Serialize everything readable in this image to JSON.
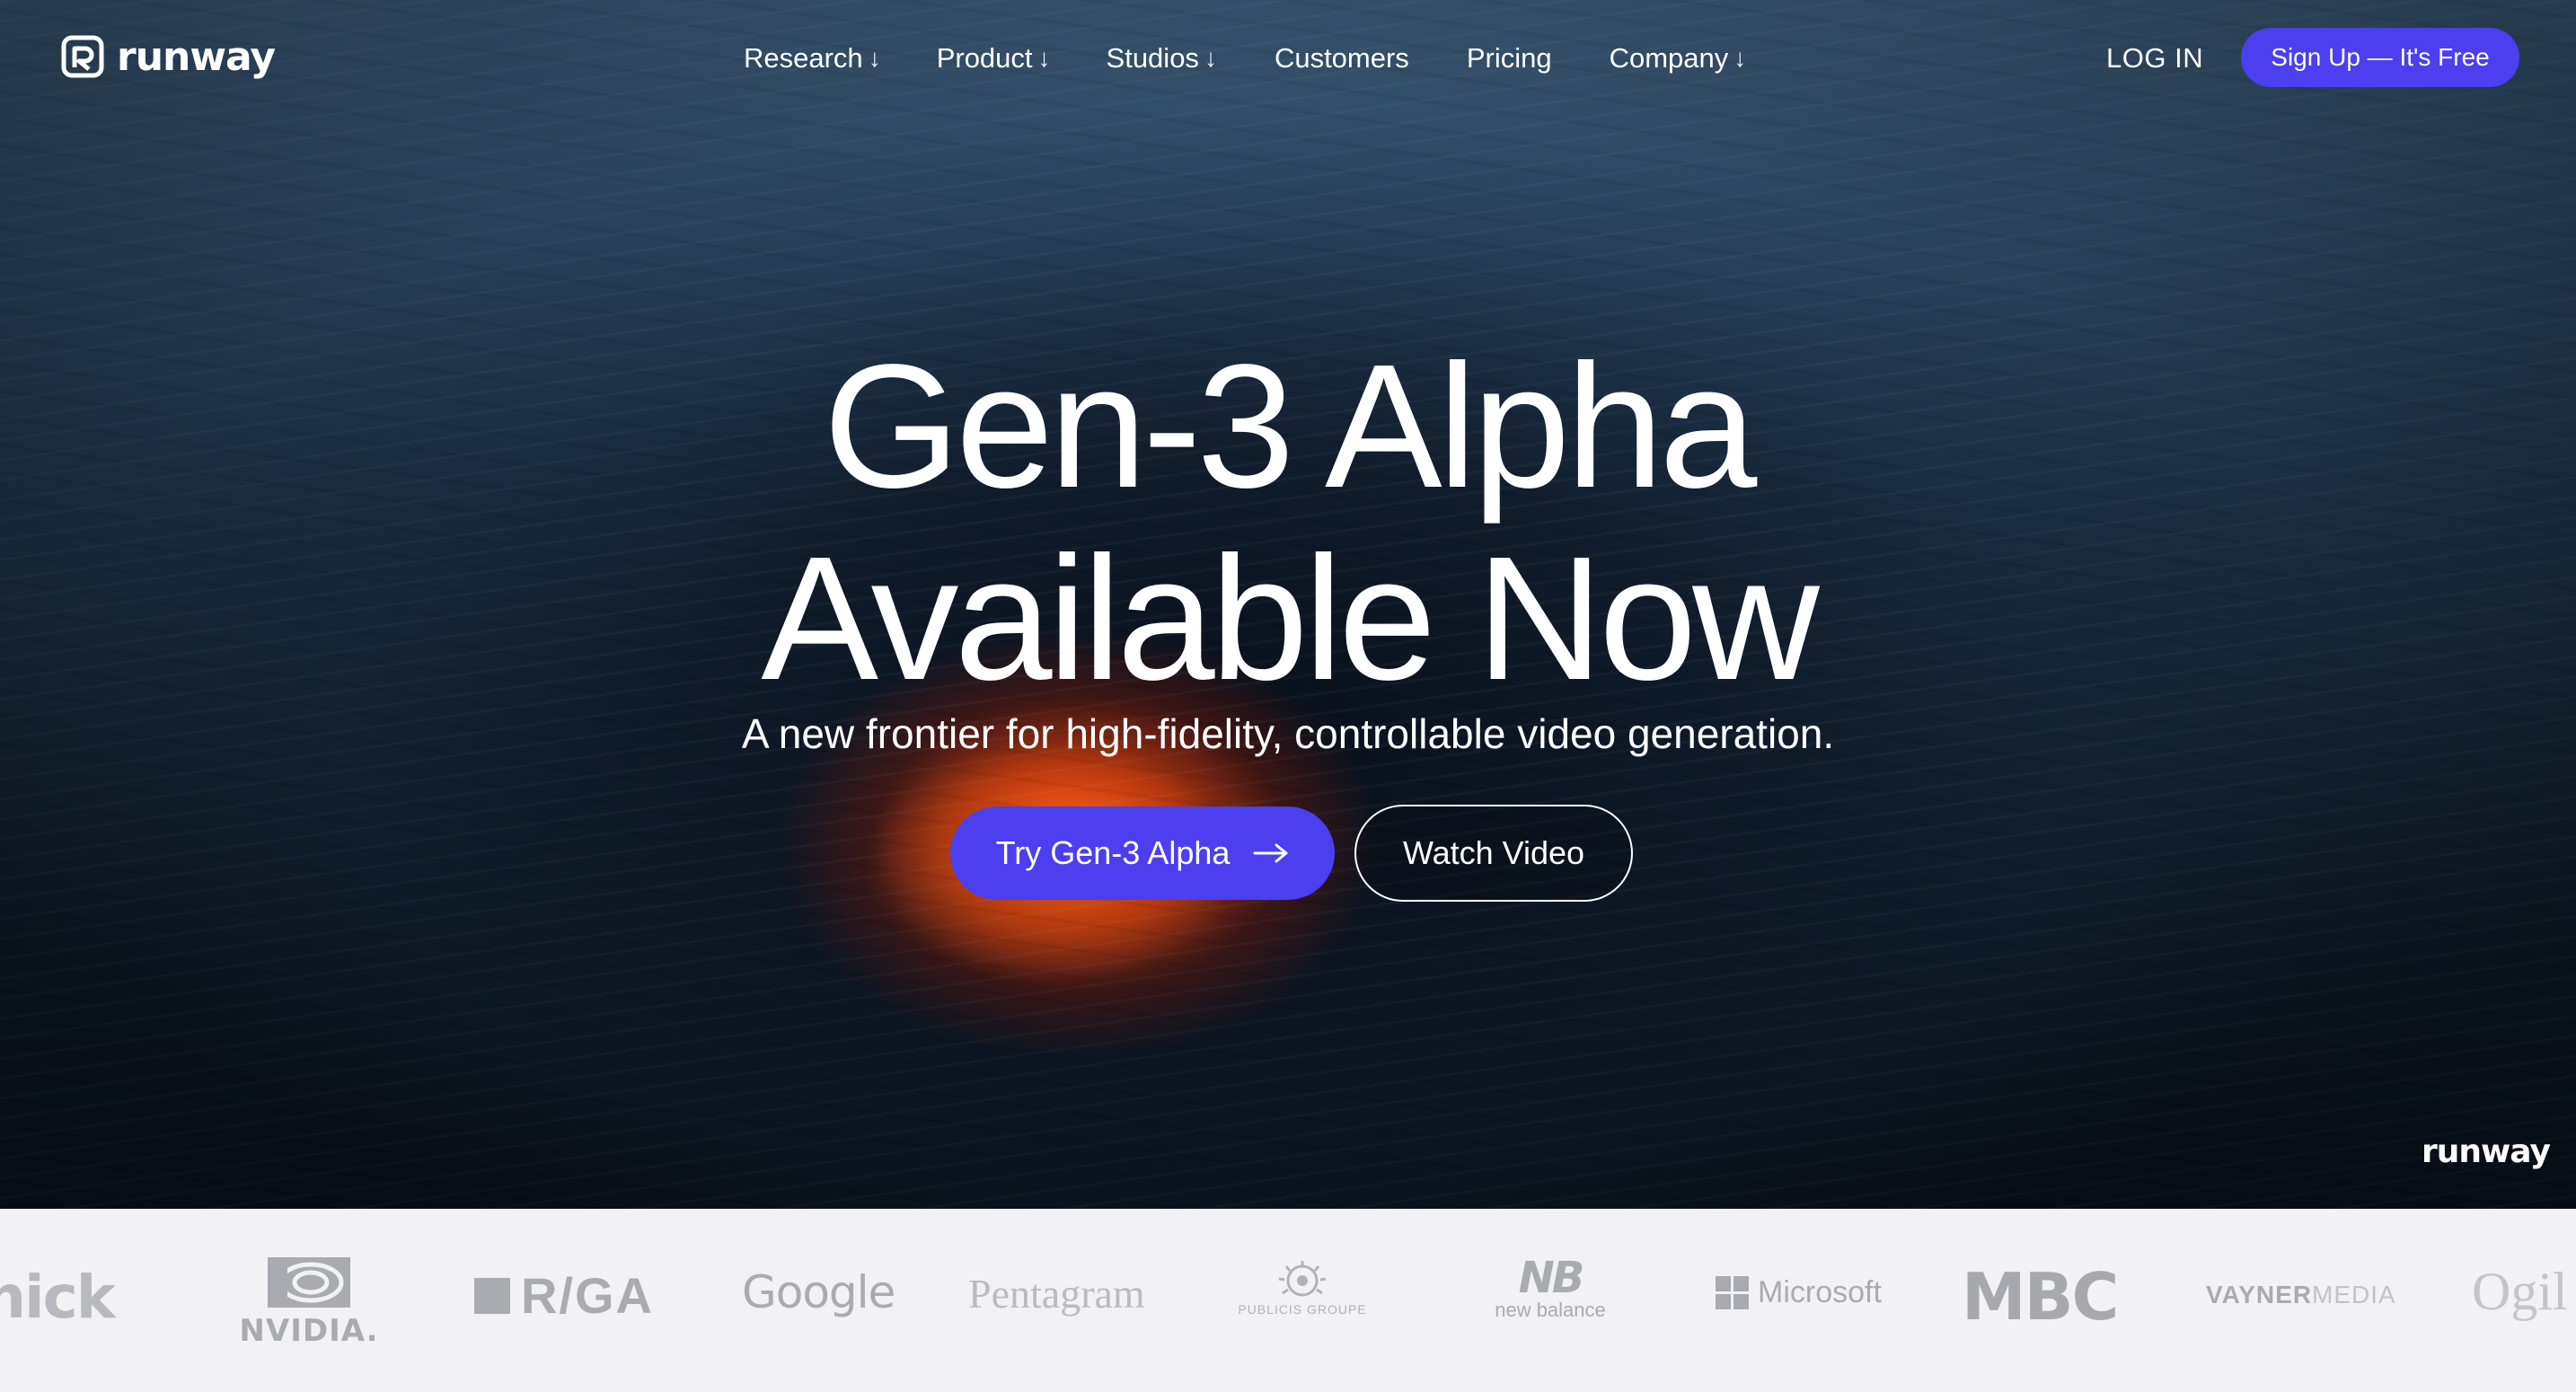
{
  "brand": {
    "name": "runway",
    "watermark": "runway"
  },
  "nav": {
    "links": [
      {
        "label": "Research",
        "has_dropdown": true
      },
      {
        "label": "Product",
        "has_dropdown": true
      },
      {
        "label": "Studios",
        "has_dropdown": true
      },
      {
        "label": "Customers",
        "has_dropdown": false
      },
      {
        "label": "Pricing",
        "has_dropdown": false
      },
      {
        "label": "Company",
        "has_dropdown": true
      }
    ],
    "dropdown_glyph": "↓",
    "login_label": "LOG IN",
    "signup_label": "Sign Up — It's Free"
  },
  "hero": {
    "headline_line1": "Gen-3 Alpha",
    "headline_line2": "Available Now",
    "subheadline": "A new frontier for high-fidelity, controllable video generation.",
    "primary_cta": "Try Gen-3 Alpha",
    "secondary_cta": "Watch Video"
  },
  "customer_logos": [
    {
      "name": "nick",
      "text": "nick"
    },
    {
      "name": "nvidia",
      "text": "NVIDIA."
    },
    {
      "name": "rga",
      "text": "R/GA"
    },
    {
      "name": "google",
      "text": "Google"
    },
    {
      "name": "pentagram",
      "text": "Pentagram"
    },
    {
      "name": "publicis",
      "text": "PUBLICIS GROUPE"
    },
    {
      "name": "new-balance",
      "text": "new balance"
    },
    {
      "name": "microsoft",
      "text": "Microsoft"
    },
    {
      "name": "mbc",
      "text": "MBC"
    },
    {
      "name": "vaynermedia",
      "text_bold": "VAYNER",
      "text_light": "MEDIA"
    },
    {
      "name": "ogilvy",
      "text": "Ogil"
    }
  ],
  "colors": {
    "accent": "#4b3ff0",
    "strip_background": "#f2f2f4",
    "logo_gray": "#a9abb1"
  },
  "icons": {
    "logo": "runway-logo-icon",
    "cta_arrow": "arrow-right-icon",
    "dropdown": "arrow-down-icon"
  }
}
